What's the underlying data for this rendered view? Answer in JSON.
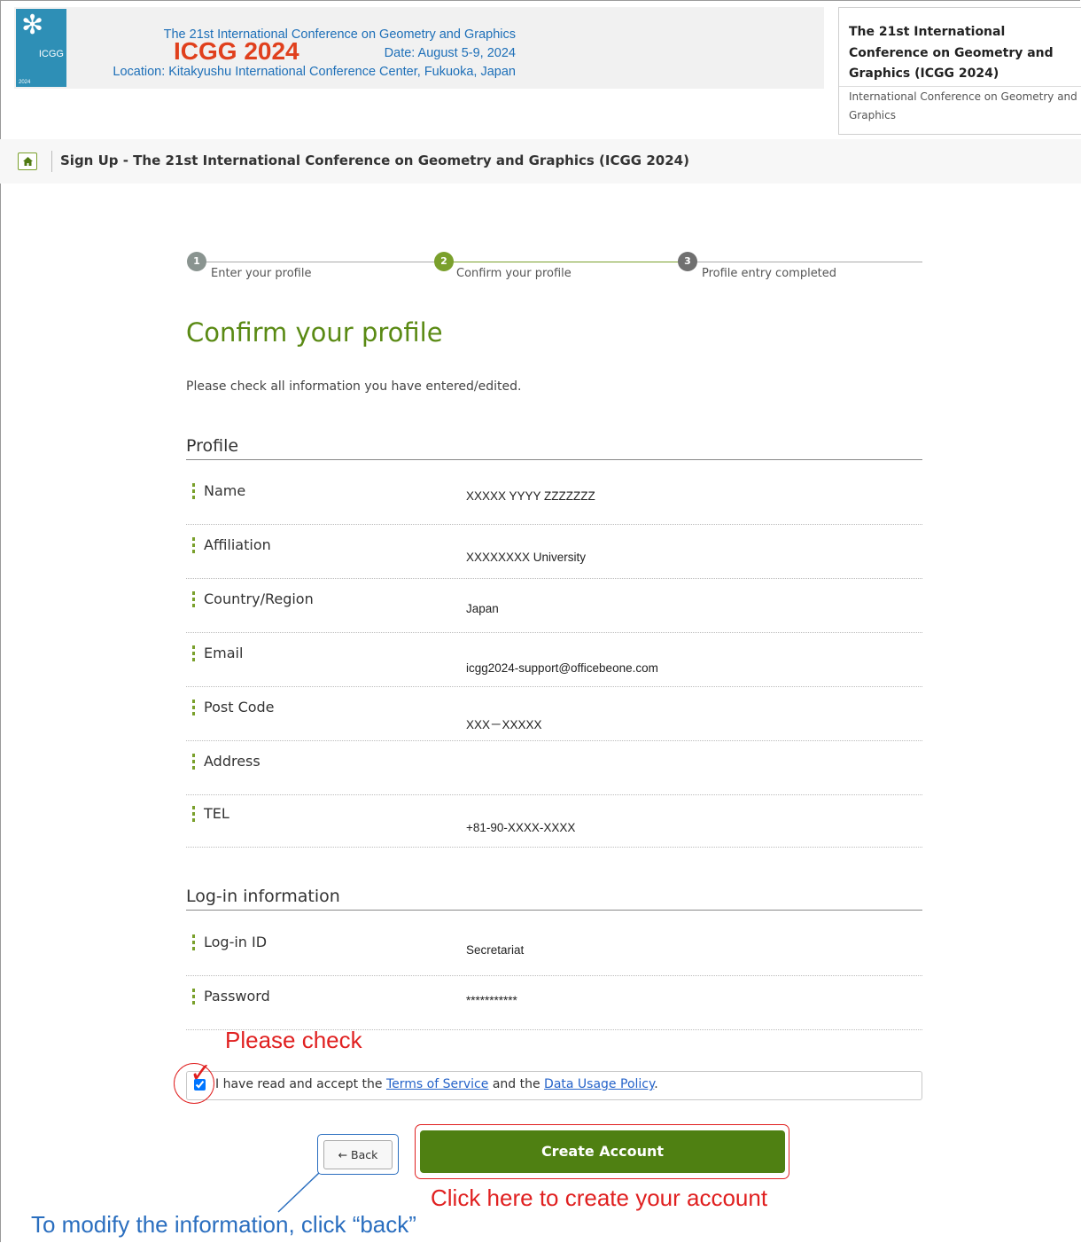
{
  "banner": {
    "logo_text": "ICGG",
    "logo_year": "2024",
    "brand": "ICGG 2024",
    "lines": [
      "The 21st International Conference on Geometry and Graphics",
      "Date: August 5-9, 2024",
      "Location: Kitakyushu International Conference Center, Fukuoka, Japan"
    ]
  },
  "card": {
    "title": "The 21st International Conference on Geometry and Graphics (ICGG 2024)",
    "subtitle": "International Conference on Geometry and Graphics"
  },
  "breadcrumb": {
    "title": "Sign Up - The 21st International Conference on Geometry and Graphics (ICGG 2024)"
  },
  "steps": [
    {
      "num": "1",
      "label": "Enter your profile"
    },
    {
      "num": "2",
      "label": "Confirm your profile"
    },
    {
      "num": "3",
      "label": "Profile entry completed"
    }
  ],
  "heading": "Confirm your profile",
  "intro": "Please check all information you have entered/edited.",
  "profile": {
    "title": "Profile",
    "fields": [
      {
        "label": "Name",
        "value": "XXXXX YYYY ZZZZZZZ"
      },
      {
        "label": "Affiliation",
        "value": "XXXXXXXX University"
      },
      {
        "label": "Country/Region",
        "value": "Japan"
      },
      {
        "label": "Email",
        "value": "icgg2024-support@officebeone.com"
      },
      {
        "label": "Post Code",
        "value": "XXX－XXXXX"
      },
      {
        "label": "Address",
        "value": ""
      },
      {
        "label": "TEL",
        "value": "+81-90-XXXX-XXXX"
      }
    ]
  },
  "login": {
    "title": "Log-in information",
    "fields": [
      {
        "label": "Log-in ID",
        "value": "Secretariat"
      },
      {
        "label": "Password",
        "value": "***********"
      }
    ]
  },
  "agreement": {
    "prefix": "I have read and accept the ",
    "terms": "Terms of Service",
    "middle": " and the ",
    "policy": "Data Usage Policy",
    "suffix": "."
  },
  "buttons": {
    "back": "← Back",
    "create": "Create Account"
  },
  "annotations": {
    "please_check": "Please check",
    "create_note": "Click here to create your account",
    "back_note": "To modify the information, click “back”"
  },
  "colors": {
    "accent_green": "#5a8a14",
    "button_green": "#4f8012",
    "annotation_red": "#e02020",
    "annotation_blue": "#2a6ebf",
    "brand_red": "#e0401d",
    "banner_blue": "#1d6fb8"
  },
  "icons": {
    "home": "home-icon",
    "check": "check-mark-icon"
  }
}
